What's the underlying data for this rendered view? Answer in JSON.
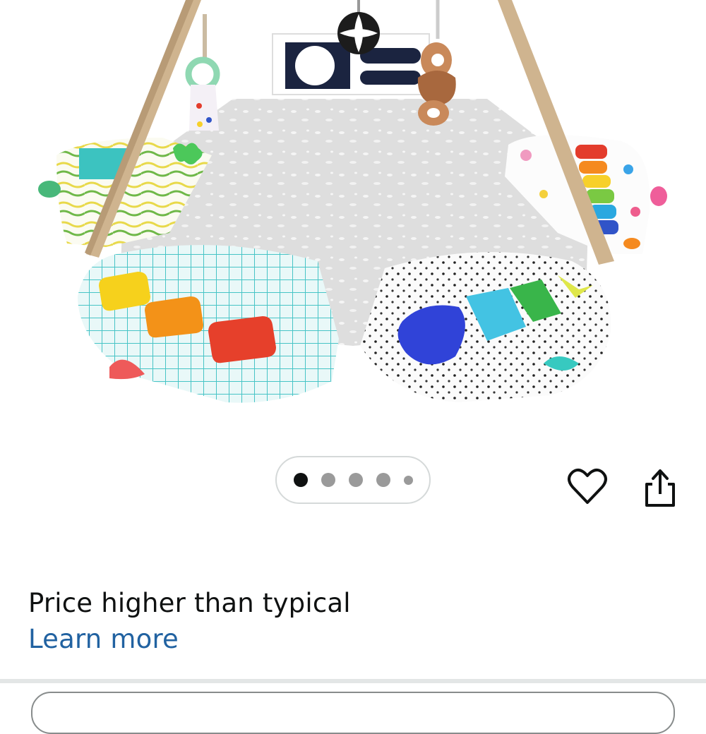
{
  "product": {
    "image_alt": "Baby activity gym play mat with wooden frame and hanging toys"
  },
  "carousel": {
    "total_images": 5,
    "active_index": 0
  },
  "icons": {
    "wishlist": "heart-icon",
    "share": "share-icon"
  },
  "price_insight": {
    "message": "Price higher than typical",
    "link_label": "Learn more"
  },
  "colors": {
    "link": "#2162a1",
    "text": "#0f1111",
    "dot_active": "#0f1111",
    "dot_inactive": "#9a9a9a"
  }
}
